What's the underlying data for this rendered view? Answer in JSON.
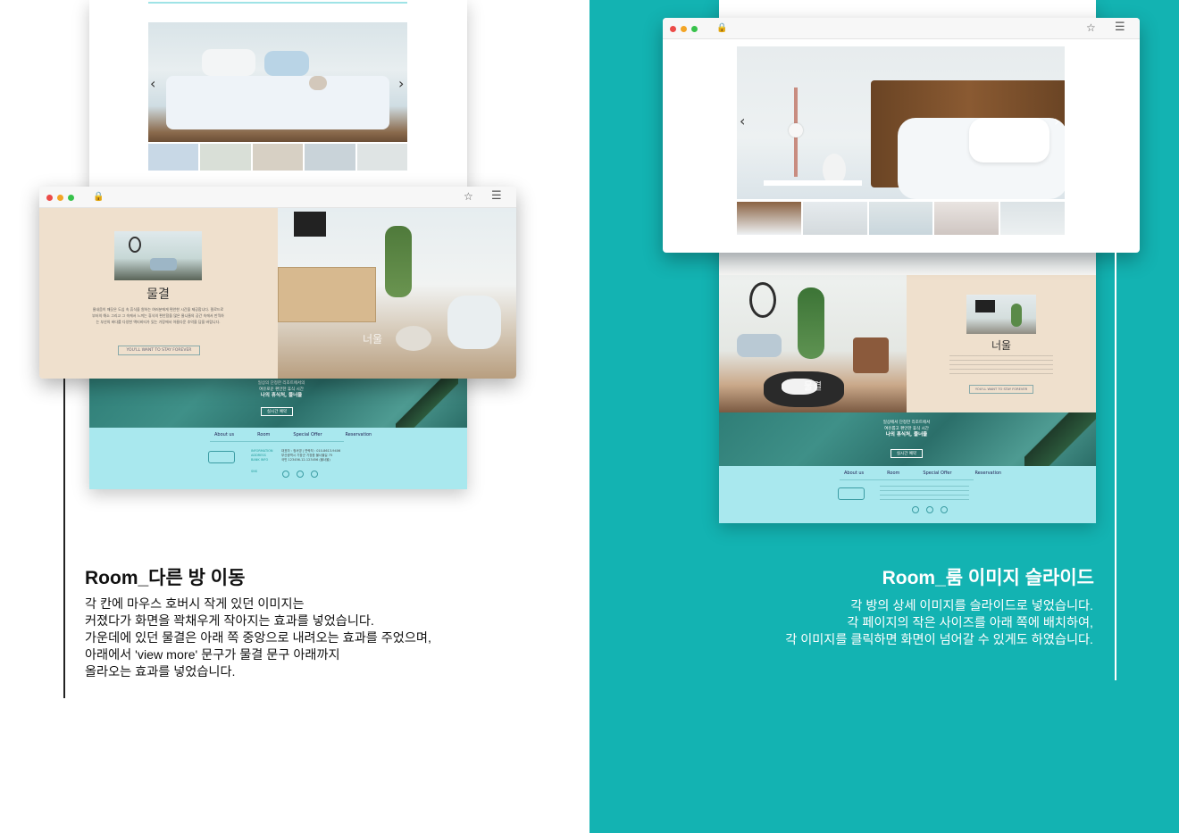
{
  "left": {
    "heading": "Room_다른 방 이동",
    "body_lines": [
      "각 칸에 마우스 호버시 작게 있던 이미지는",
      "커졌다가 화면을 꽉채우게 작아지는 효과를 넣었습니다.",
      "가운데에 있던 물결은 아래 쪽 중앙으로 내려오는 효과를 주었으며,",
      "아래에서 'view more' 문구가 물결 문구 아래까지",
      "올라오는 효과를 넣었습니다."
    ],
    "mockup": {
      "room_name": "물결",
      "overlay_room_name": "너울",
      "room_desc": "물내음이 깨끗은 도심 속 휴식을 원하는 여러분에게 편안한 시간을 제공합니다. 필로드로부터의 해소 그리고 그 속에서 느끼는 휴식의 편안함을 많은 물니울의 공간 속에서 만끽하는 부산의 바다를 다양한 액티비티가 있는 가장에서 아름다운 추억을 담을 바랍니다.",
      "cta": "YOU'LL WANT TO STAY FOREVER",
      "pool_line1": "일상의 단정한 리조트에서의",
      "pool_line2": "여유로운 편안한 휴식 시간",
      "pool_title": "나의 휴식처, 물너울",
      "pool_button": "실시간 예약",
      "nav": [
        "About us",
        "Room",
        "Special Offer",
        "Reservation"
      ],
      "footer_labels": [
        "INFORMATION",
        "ADDRESS",
        "BANK INFO",
        "SNS"
      ],
      "footer_values": [
        "대표자 : 정서영 | 연락처 : 010-8613-9406",
        "부산광역시 기장군 기장읍 물너울길 75",
        "국민 123456-12-123456 (물너울)"
      ]
    }
  },
  "right": {
    "heading": "Room_룸 이미지 슬라이드",
    "body_lines": [
      "각 방의 상세 이미지를 슬라이드로 넣었습니다.",
      "각 페이지의 작은 사이즈를 아래 쪽에 배치하여,",
      "각 이미지를 클릭하면 화면이 넘어갈 수 있게도 하였습니다."
    ],
    "mockup": {
      "room_name": "너울",
      "overlay_room_name": "물결",
      "cta": "YOU'LL WANT TO STAY FOREVER",
      "pool_line1": "일상에서 단정한 리조트에서",
      "pool_line2": "여유롭고 편안한 휴식 시간",
      "pool_title": "나의 휴식처, 물너울",
      "pool_button": "실시간 예약",
      "nav": [
        "About us",
        "Room",
        "Special Offer",
        "Reservation"
      ]
    }
  },
  "colors": {
    "teal": "#13b3b2",
    "beige": "#efe0cd",
    "footer": "#a9e8ee"
  },
  "icons": [
    "lock-icon",
    "bookmark-star-icon",
    "hamburger-menu-icon",
    "chevron-left-icon",
    "chevron-right-icon",
    "instagram-icon",
    "facebook-icon",
    "youtube-icon"
  ]
}
